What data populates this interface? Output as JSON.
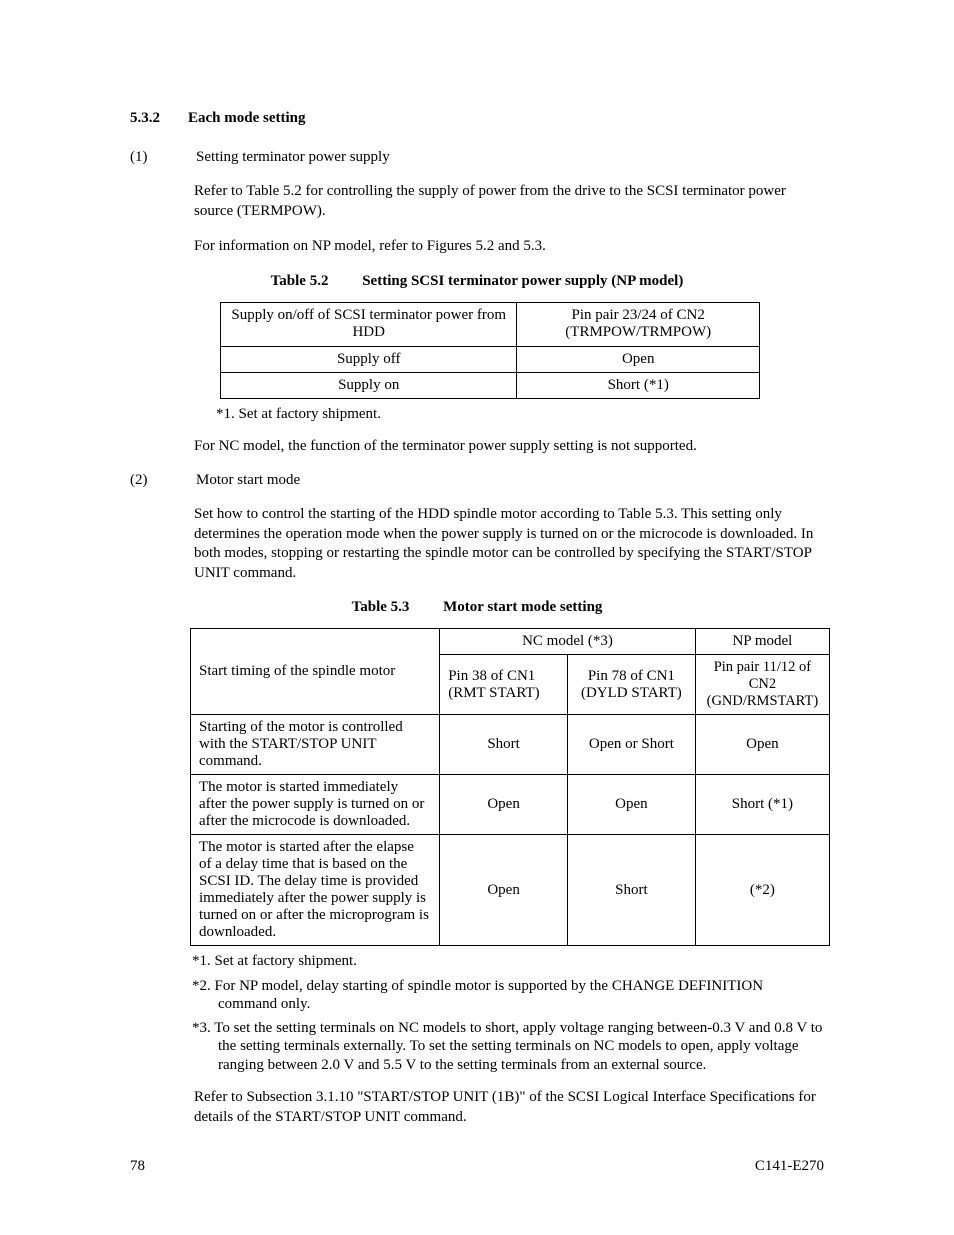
{
  "section": {
    "number": "5.3.2",
    "title": "Each mode setting"
  },
  "sub1": {
    "num": "(1)",
    "title": "Setting terminator power supply",
    "para1": "Refer to Table 5.2 for controlling the supply of power from the drive to the SCSI terminator power source (TERMPOW).",
    "para2": "For information on NP model, refer to Figures 5.2 and 5.3."
  },
  "table52": {
    "caption_num": "Table 5.2",
    "caption_title": "Setting SCSI terminator power supply (NP model)",
    "header_left": "Supply on/off of SCSI terminator power from HDD",
    "header_right": "Pin pair 23/24 of CN2 (TRMPOW/TRMPOW)",
    "r1c1": "Supply off",
    "r1c2": "Open",
    "r2c1": "Supply on",
    "r2c2": "Short (*1)",
    "footnote1": "*1.   Set at factory shipment.",
    "post": "For NC model, the function of the terminator power supply setting is not supported."
  },
  "sub2": {
    "num": "(2)",
    "title": "Motor start mode",
    "para1": "Set how to control the starting of the HDD spindle motor according to Table 5.3.  This setting only determines the operation mode when the power supply is turned on or the microcode is downloaded.  In both modes, stopping or restarting the spindle motor can be controlled by specifying the START/STOP UNIT command."
  },
  "table53": {
    "caption_num": "Table 5.3",
    "caption_title": "Motor start mode setting",
    "h_left": "Start timing of the spindle motor",
    "h_nc": "NC model (*3)",
    "h_np": "NP model",
    "h_c2": "Pin 38 of CN1 (RMT START)",
    "h_c3": "Pin 78 of CN1 (DYLD START)",
    "h_c4": "Pin pair 11/12 of CN2 (GND/RMSTART)",
    "r1c1": "Starting of the motor is controlled with the START/STOP UNIT command.",
    "r1c2": "Short",
    "r1c3": "Open or Short",
    "r1c4": "Open",
    "r2c1": "The motor is started immediately after the power supply is turned on or after the microcode is downloaded.",
    "r2c2": "Open",
    "r2c3": "Open",
    "r2c4": "Short (*1)",
    "r3c1": "The motor is started after the elapse of a delay time that is based on the SCSI ID.  The delay time is provided immediately after the power supply is turned on or after the microprogram is downloaded.",
    "r3c2": "Open",
    "r3c3": "Short",
    "r3c4": "(*2)",
    "footnote1": "*1. Set at factory shipment.",
    "footnote2": "*2. For NP model, delay starting of spindle motor is supported by the CHANGE  DEFINITION command only.",
    "footnote3": "*3. To set the setting terminals on NC models to short, apply voltage ranging between-0.3 V and 0.8 V to the setting terminals externally.  To set the setting terminals on NC models to open, apply voltage ranging between 2.0 V and 5.5 V to the setting terminals from an external source.",
    "post": "Refer to Subsection 3.1.10 \"START/STOP UNIT (1B)\" of the SCSI Logical Interface Specifications for details of the START/STOP UNIT command."
  },
  "footer": {
    "page": "78",
    "docid": "C141-E270"
  }
}
